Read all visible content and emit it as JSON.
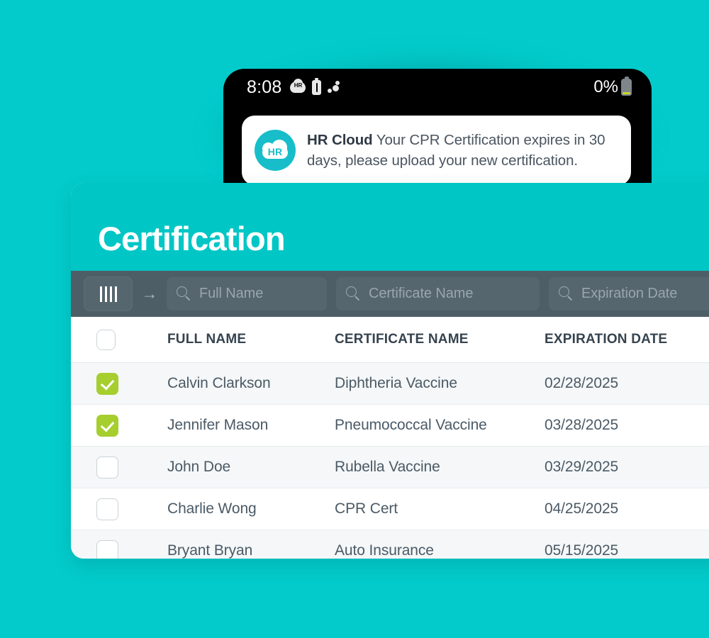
{
  "theme": {
    "background_teal": "#03CBCB",
    "header_teal": "#00C6C6",
    "toolbar_slate": "#4E5E66",
    "checkbox_green": "#A6CE2E",
    "logo_teal": "#17BECA"
  },
  "phone": {
    "status_bar": {
      "time": "8:08",
      "battery_percent": "0%",
      "left_icons": [
        "hr-cloud-icon",
        "battery-warning-icon",
        "share-dots-icon"
      ],
      "right_icon": "battery-empty-icon"
    },
    "notification": {
      "logo_text": "HR",
      "app_name": "HR Cloud",
      "message": " Your CPR Certification expires in 30 days, please upload your new certification."
    }
  },
  "cert_panel": {
    "title": "Certification",
    "toolbar": {
      "columns_button": "columns-icon",
      "arrow_button": "→",
      "search_fields": [
        {
          "placeholder": "Full Name",
          "value": ""
        },
        {
          "placeholder": "Certificate Name",
          "value": ""
        },
        {
          "placeholder": "Expiration Date",
          "value": ""
        }
      ]
    },
    "table": {
      "columns": [
        "FULL NAME",
        "CERTIFICATE NAME",
        "EXPIRATION DATE"
      ],
      "select_all_checked": false,
      "rows": [
        {
          "checked": true,
          "full_name": "Calvin Clarkson",
          "certificate_name": "Diphtheria Vaccine",
          "expiration_date": "02/28/2025"
        },
        {
          "checked": true,
          "full_name": "Jennifer Mason",
          "certificate_name": "Pneumococcal Vaccine",
          "expiration_date": "03/28/2025"
        },
        {
          "checked": false,
          "full_name": "John Doe",
          "certificate_name": "Rubella Vaccine",
          "expiration_date": "03/29/2025"
        },
        {
          "checked": false,
          "full_name": "Charlie Wong",
          "certificate_name": "CPR Cert",
          "expiration_date": "04/25/2025"
        },
        {
          "checked": false,
          "full_name": "Bryant Bryan",
          "certificate_name": "Auto Insurance",
          "expiration_date": "05/15/2025"
        }
      ]
    }
  }
}
